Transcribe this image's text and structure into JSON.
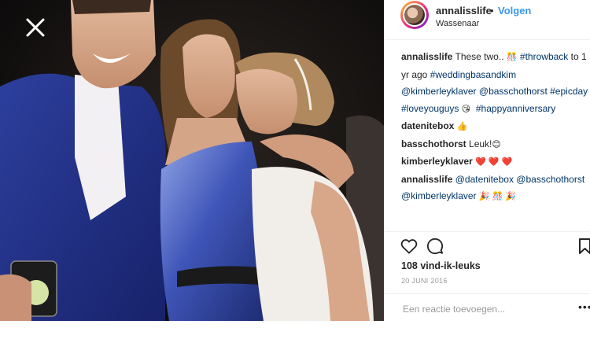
{
  "post": {
    "username": "annalisslife",
    "dot": "•",
    "follow_label": "Volgen",
    "location": "Wassenaar"
  },
  "comments": [
    {
      "user": "annalisslife",
      "lines": [
        [
          "These two.. ",
          {
            "emoji": "🎊"
          },
          " ",
          {
            "tag": "#throwback"
          },
          " to 1"
        ],
        [
          "yr ago ",
          {
            "tag": "#weddingbasandkim"
          }
        ],
        [
          {
            "tag": "@kimberleyklaver"
          },
          " ",
          {
            "tag": "@basschothorst"
          },
          " ",
          {
            "tag": "#epicday"
          }
        ],
        [
          {
            "tag": "#loveyouguys"
          },
          " ",
          {
            "emoji": "😘"
          },
          "  ",
          {
            "tag": "#happyanniversary"
          }
        ]
      ]
    },
    {
      "user": "datenitebox",
      "lines": [
        [
          {
            "emoji": "👍"
          }
        ]
      ]
    },
    {
      "user": "basschothorst",
      "lines": [
        [
          "Leuk!",
          {
            "emoji": "😊"
          }
        ]
      ]
    },
    {
      "user": "kimberleyklaver",
      "lines": [
        [
          {
            "emoji": "❤️ ❤️ ❤️"
          }
        ]
      ]
    },
    {
      "user": "annalisslife",
      "lines": [
        [
          {
            "tag": "@datenitebox"
          },
          " ",
          {
            "tag": "@basschothorst"
          }
        ],
        [
          {
            "tag": "@kimberleyklaver"
          },
          " ",
          {
            "emoji": "🎉 🎊 🎉"
          }
        ]
      ]
    }
  ],
  "stats": {
    "likes": "108 vind-ik-leuks",
    "date": "20 JUNI 2016"
  },
  "add_comment": {
    "placeholder": "Een reactie toevoegen...",
    "more": "•••"
  },
  "icons": {
    "close": "close-icon",
    "like": "heart-icon",
    "comment": "comment-icon",
    "share": "share-icon"
  },
  "colors": {
    "link": "#003569",
    "follow": "#3897f0",
    "muted": "#999999"
  }
}
